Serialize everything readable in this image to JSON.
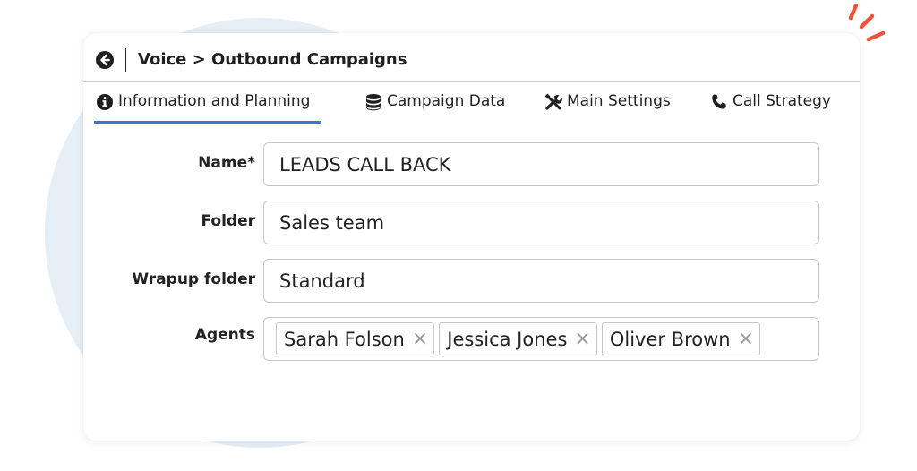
{
  "header": {
    "breadcrumb": "Voice > Outbound Campaigns"
  },
  "tabs": [
    {
      "label": "Information and Planning",
      "icon": "info-circle-icon",
      "active": true
    },
    {
      "label": "Campaign Data",
      "icon": "database-icon",
      "active": false
    },
    {
      "label": "Main Settings",
      "icon": "tools-icon",
      "active": false
    },
    {
      "label": "Call Strategy",
      "icon": "phone-icon",
      "active": false
    }
  ],
  "form": {
    "name": {
      "label": "Name*",
      "value": "LEADS CALL BACK"
    },
    "folder": {
      "label": "Folder",
      "value": "Sales team"
    },
    "wrapup_folder": {
      "label": "Wrapup folder",
      "value": "Standard"
    },
    "agents": {
      "label": "Agents",
      "tags": [
        "Sarah Folson",
        "Jessica Jones",
        "Oliver Brown"
      ],
      "remove_glyph": "×"
    }
  },
  "colors": {
    "accent_underline": "#3a74d8",
    "decor_strokes": "#e8553a",
    "background_circle": "#e6eef6"
  }
}
